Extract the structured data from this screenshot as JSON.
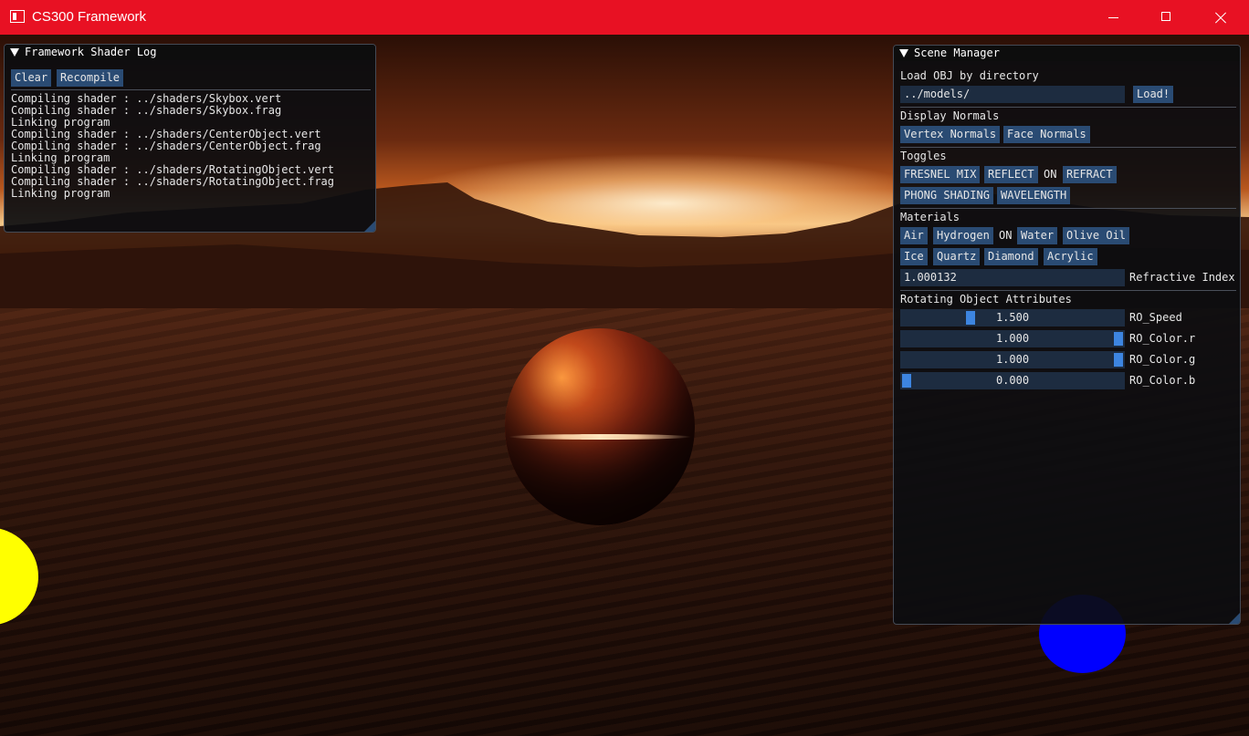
{
  "window": {
    "title": "CS300 Framework"
  },
  "shader_log": {
    "title": "Framework Shader Log",
    "clear_label": "Clear",
    "recompile_label": "Recompile",
    "lines": [
      "Compiling shader : ../shaders/Skybox.vert",
      "Compiling shader : ../shaders/Skybox.frag",
      "Linking program",
      "Compiling shader : ../shaders/CenterObject.vert",
      "Compiling shader : ../shaders/CenterObject.frag",
      "Linking program",
      "Compiling shader : ../shaders/RotatingObject.vert",
      "Compiling shader : ../shaders/RotatingObject.frag",
      "Linking program"
    ]
  },
  "scene_manager": {
    "title": "Scene Manager",
    "load_obj": {
      "label": "Load OBJ by directory",
      "value": "../models/",
      "button": "Load!"
    },
    "display_normals": {
      "label": "Display Normals",
      "vertex": "Vertex Normals",
      "face": "Face Normals"
    },
    "toggles": {
      "label": "Toggles",
      "fresnel_mix": "FRESNEL MIX",
      "reflect": "REFLECT",
      "on_text": "ON",
      "refract": "REFRACT",
      "phong_shading": "PHONG SHADING",
      "wavelength": "WAVELENGTH"
    },
    "materials": {
      "label": "Materials",
      "air": "Air",
      "hydrogen": "Hydrogen",
      "on_text": "ON",
      "water": "Water",
      "olive_oil": "Olive Oil",
      "ice": "Ice",
      "quartz": "Quartz",
      "diamond": "Diamond",
      "acrylic": "Acrylic",
      "refractive_index_value": "1.000132",
      "refractive_index_label": "Refractive Index"
    },
    "rotating_object": {
      "label": "Rotating Object Attributes",
      "sliders": [
        {
          "name": "RO_Speed",
          "value": "1.500",
          "fraction": 0.3
        },
        {
          "name": "RO_Color.r",
          "value": "1.000",
          "fraction": 1.0
        },
        {
          "name": "RO_Color.g",
          "value": "1.000",
          "fraction": 1.0
        },
        {
          "name": "RO_Color.b",
          "value": "0.000",
          "fraction": 0.0
        }
      ]
    }
  },
  "colors": {
    "title_bar": "#e81123",
    "button": "#2a4b73",
    "slider_grab": "#3d85e0",
    "yellow_sphere": "#ffff00",
    "blue_sphere": "#0000ff"
  }
}
